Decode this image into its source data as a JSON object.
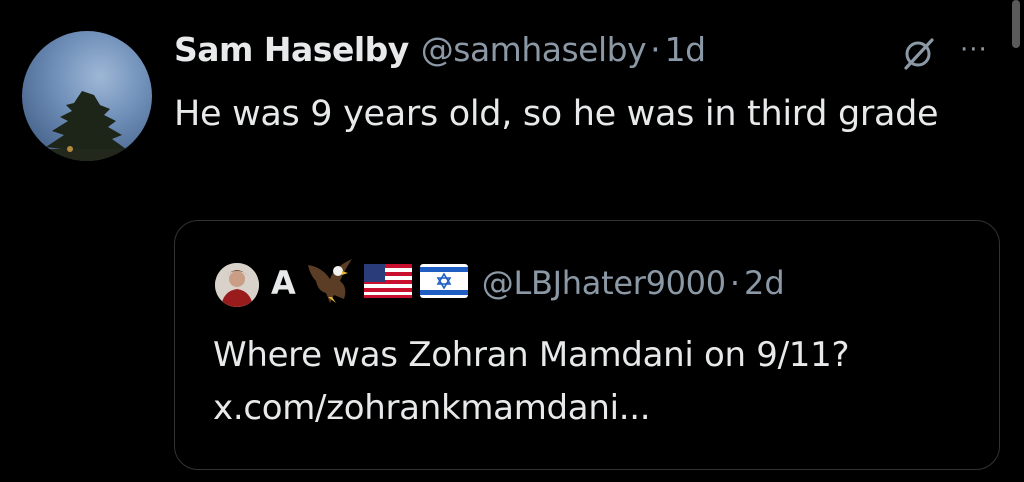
{
  "tweet": {
    "author_name": "Sam Haselby",
    "author_handle": "@samhaselby",
    "separator": "·",
    "time": "1d",
    "text": "He was 9 years old, so he was in third grade",
    "more_label": "···"
  },
  "quote": {
    "author_name": "A",
    "author_badges": [
      "eagle-emoji",
      "us-flag-emoji",
      "israel-flag-emoji"
    ],
    "author_handle": "@LBJhater9000",
    "separator": "·",
    "time": "2d",
    "text": "Where was Zohran Mamdani on 9/11? x.com/zohrankmamdani..."
  },
  "colors": {
    "background": "#000000",
    "primary_text": "#e7e9ea",
    "secondary_text": "#8b98a5",
    "card_border": "#2f3336"
  }
}
